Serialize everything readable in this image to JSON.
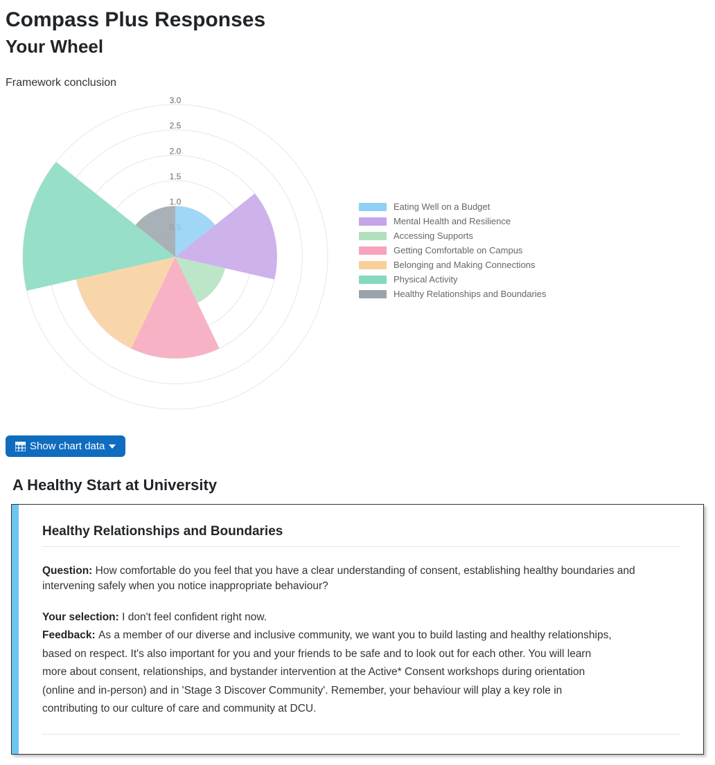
{
  "header": {
    "title": "Compass Plus Responses",
    "subtitle": "Your Wheel",
    "conclusion_label": "Framework conclusion"
  },
  "chart_data": {
    "type": "polar-area",
    "max": 3.0,
    "ticks": [
      "0.5",
      "1.0",
      "1.5",
      "2.0",
      "2.5",
      "3.0"
    ],
    "series": [
      {
        "name": "Eating Well on a Budget",
        "value": 1.0,
        "color": "#8fd0f4"
      },
      {
        "name": "Mental Health and Resilience",
        "value": 2.0,
        "color": "#c4a5e8"
      },
      {
        "name": "Accessing Supports",
        "value": 1.0,
        "color": "#b1e0bd"
      },
      {
        "name": "Getting Comfortable on Campus",
        "value": 2.0,
        "color": "#f6a4bb"
      },
      {
        "name": "Belonging and Making Connections",
        "value": 2.0,
        "color": "#f8cf9a"
      },
      {
        "name": "Physical Activity",
        "value": 3.0,
        "color": "#85d9c0"
      },
      {
        "name": "Healthy Relationships and Boundaries",
        "value": 1.0,
        "color": "#9aa3ac"
      }
    ]
  },
  "button": {
    "label": "Show chart data"
  },
  "section": {
    "title": "A Healthy Start at University"
  },
  "card": {
    "title": "Healthy Relationships and Boundaries",
    "question_label": "Question:",
    "question_text": "How comfortable do you feel that you have a clear understanding of consent, establishing healthy boundaries and intervening safely when you notice inappropriate behaviour?",
    "selection_label": "Your selection:",
    "selection_text": "I don't feel confident right now.",
    "feedback_label": "Feedback:",
    "feedback_lines": [
      "As a member of our diverse and inclusive community, we want you to build lasting and healthy relationships,",
      "based on respect. It's also important for you and your friends to be safe and to look out for each other. You will learn",
      "more about consent, relationships, and bystander intervention at the Active* Consent workshops during orientation",
      "(online and in-person) and in 'Stage 3 Discover Community'. Remember, your behaviour will play a key role in",
      "contributing to our culture of care and community at DCU."
    ]
  }
}
